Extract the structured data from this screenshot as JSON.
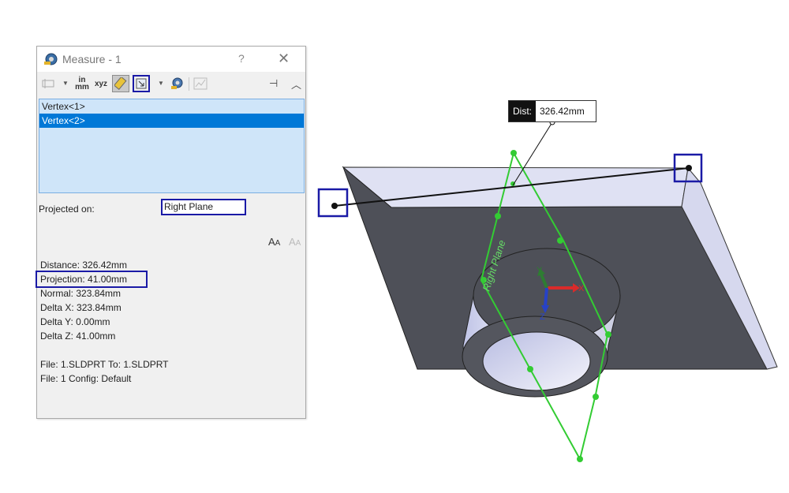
{
  "dialog": {
    "title": "Measure - 1",
    "help": "?",
    "close": "✕",
    "toolbar": {
      "units_top": "in",
      "units_bottom": "mm",
      "xyz": "xyz"
    },
    "selections": [
      "Vertex<1>",
      "Vertex<2>"
    ],
    "projected_on_label": "Projected on:",
    "projected_on_value": "Right Plane",
    "results": [
      "Distance: 326.42mm",
      "Projection: 41.00mm",
      "Normal: 323.84mm",
      "Delta X: 323.84mm",
      "Delta Y: 0.00mm",
      "Delta Z: 41.00mm"
    ],
    "files": [
      "File: 1.SLDPRT To: 1.SLDPRT",
      "File: 1 Config: Default"
    ]
  },
  "viewport": {
    "dist_label": "Dist:",
    "dist_value": "326.42mm",
    "plane_label": "Right Plane",
    "triad": {
      "x": "X",
      "y": "Y",
      "z": "Z"
    }
  },
  "colors": {
    "highlight_border": "#1a1aa6",
    "selected_row": "#0078d7",
    "plane_green": "#33cc33",
    "body_dark": "#4e5058",
    "body_light": "#dfe1f3"
  }
}
